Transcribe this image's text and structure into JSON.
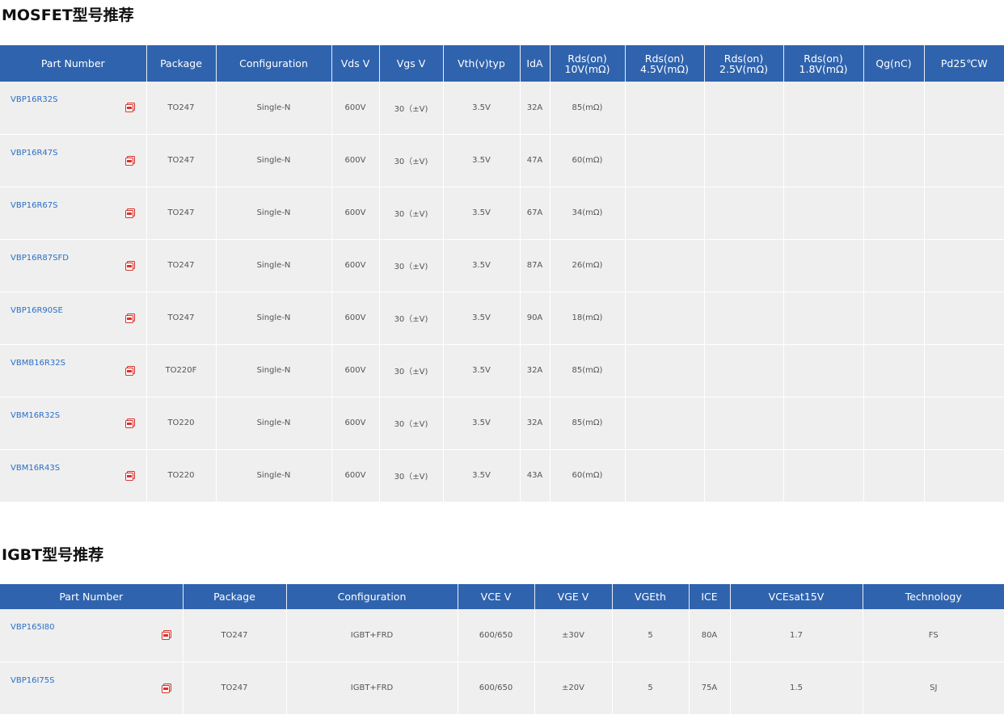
{
  "mosfet": {
    "title": "MOSFET型号推荐",
    "headers": {
      "part_number": "Part Number",
      "package": "Package",
      "configuration": "Configuration",
      "vds": "Vds V",
      "vgs": "Vgs V",
      "vth": "Vth(v)typ",
      "id": "IdA",
      "rds10_l1": "Rds(on)",
      "rds10_l2": "10V(mΩ)",
      "rds45_l1": "Rds(on)",
      "rds45_l2": "4.5V(mΩ)",
      "rds25_l1": "Rds(on)",
      "rds25_l2": "2.5V(mΩ)",
      "rds18_l1": "Rds(on)",
      "rds18_l2": "1.8V(mΩ)",
      "qg": "Qg(nC)",
      "pd": "Pd25℃W"
    },
    "rows": [
      {
        "part": "VBP16R32S",
        "package": "TO247",
        "config": "Single-N",
        "vds": "600V",
        "vgs": "30（±V)",
        "vth": "3.5V",
        "id": "32A",
        "rds10": "85(mΩ)"
      },
      {
        "part": "VBP16R47S",
        "package": "TO247",
        "config": "Single-N",
        "vds": "600V",
        "vgs": "30（±V)",
        "vth": "3.5V",
        "id": "47A",
        "rds10": "60(mΩ)"
      },
      {
        "part": "VBP16R67S",
        "package": "TO247",
        "config": "Single-N",
        "vds": "600V",
        "vgs": "30（±V)",
        "vth": "3.5V",
        "id": "67A",
        "rds10": "34(mΩ)"
      },
      {
        "part": "VBP16R87SFD",
        "package": "TO247",
        "config": "Single-N",
        "vds": "600V",
        "vgs": "30（±V)",
        "vth": "3.5V",
        "id": "87A",
        "rds10": "26(mΩ)"
      },
      {
        "part": "VBP16R90SE",
        "package": "TO247",
        "config": "Single-N",
        "vds": "600V",
        "vgs": "30（±V)",
        "vth": "3.5V",
        "id": "90A",
        "rds10": "18(mΩ)"
      },
      {
        "part": "VBMB16R32S",
        "package": "TO220F",
        "config": "Single-N",
        "vds": "600V",
        "vgs": "30（±V)",
        "vth": "3.5V",
        "id": "32A",
        "rds10": "85(mΩ)"
      },
      {
        "part": "VBM16R32S",
        "package": "TO220",
        "config": "Single-N",
        "vds": "600V",
        "vgs": "30（±V)",
        "vth": "3.5V",
        "id": "32A",
        "rds10": "85(mΩ)"
      },
      {
        "part": "VBM16R43S",
        "package": "TO220",
        "config": "Single-N",
        "vds": "600V",
        "vgs": "30（±V)",
        "vth": "3.5V",
        "id": "43A",
        "rds10": "60(mΩ)"
      }
    ]
  },
  "igbt": {
    "title": "IGBT型号推荐",
    "headers": {
      "part_number": "Part Number",
      "package": "Package",
      "configuration": "Configuration",
      "vce": "VCE V",
      "vge": "VGE V",
      "vgeth": "VGEth",
      "ice": "ICE",
      "vcesat": "VCEsat15V",
      "technology": "Technology"
    },
    "rows": [
      {
        "part": "VBP165I80",
        "package": "TO247",
        "config": "IGBT+FRD",
        "vce": "600/650",
        "vge": "±30V",
        "vgeth": "5",
        "ice": "80A",
        "vcesat": "1.7",
        "tech": "FS"
      },
      {
        "part": "VBP16I75S",
        "package": "TO247",
        "config": "IGBT+FRD",
        "vce": "600/650",
        "vge": "±20V",
        "vgeth": "5",
        "ice": "75A",
        "vcesat": "1.5",
        "tech": "SJ"
      }
    ]
  },
  "icons": {
    "datasheet": "pdf-icon"
  },
  "colors": {
    "header_bg": "#2f63ad",
    "cell_bg": "#efefef",
    "link": "#2a6fc6",
    "pdf_icon": "#d9312b"
  }
}
